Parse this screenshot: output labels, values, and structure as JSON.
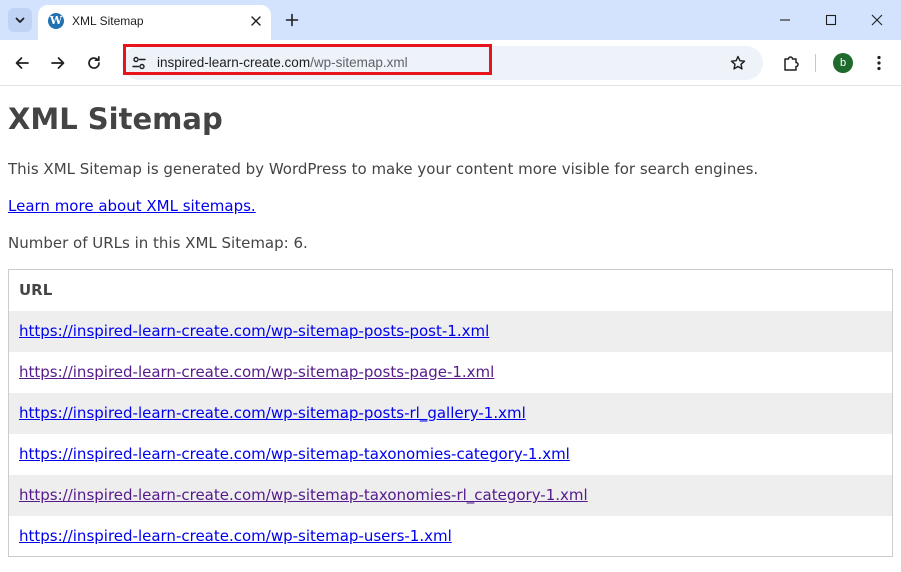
{
  "browser": {
    "tab": {
      "title": "XML Sitemap"
    },
    "omnibox": {
      "host": "inspired-learn-create.com",
      "path": "/wp-sitemap.xml"
    },
    "profile_initial": "b",
    "favicon_letter": "W"
  },
  "page": {
    "heading": "XML Sitemap",
    "description": "This XML Sitemap is generated by WordPress to make your content more visible for search engines.",
    "learn_more": "Learn more about XML sitemaps.",
    "count_text": "Number of URLs in this XML Sitemap: 6.",
    "table": {
      "header": "URL",
      "rows": [
        {
          "url": "https://inspired-learn-create.com/wp-sitemap-posts-post-1.xml",
          "visited": false
        },
        {
          "url": "https://inspired-learn-create.com/wp-sitemap-posts-page-1.xml",
          "visited": true
        },
        {
          "url": "https://inspired-learn-create.com/wp-sitemap-posts-rl_gallery-1.xml",
          "visited": false
        },
        {
          "url": "https://inspired-learn-create.com/wp-sitemap-taxonomies-category-1.xml",
          "visited": false
        },
        {
          "url": "https://inspired-learn-create.com/wp-sitemap-taxonomies-rl_category-1.xml",
          "visited": true
        },
        {
          "url": "https://inspired-learn-create.com/wp-sitemap-users-1.xml",
          "visited": false
        }
      ]
    }
  },
  "colors": {
    "link": "#0000ee",
    "visited_link": "#551a8b",
    "highlight_box": "#e8141c",
    "text": "#444444"
  },
  "icons": {
    "tab_search": "chevron-down-icon",
    "favicon": "wordpress-icon",
    "tab_close": "close-icon",
    "new_tab": "plus-icon",
    "minimize": "minimize-icon",
    "maximize": "maximize-icon",
    "close_window": "close-icon",
    "back": "arrow-left-icon",
    "forward": "arrow-right-icon",
    "reload": "reload-icon",
    "site_info": "tune-icon",
    "bookmark": "star-icon",
    "extensions": "puzzle-icon",
    "menu": "kebab-menu-icon"
  }
}
